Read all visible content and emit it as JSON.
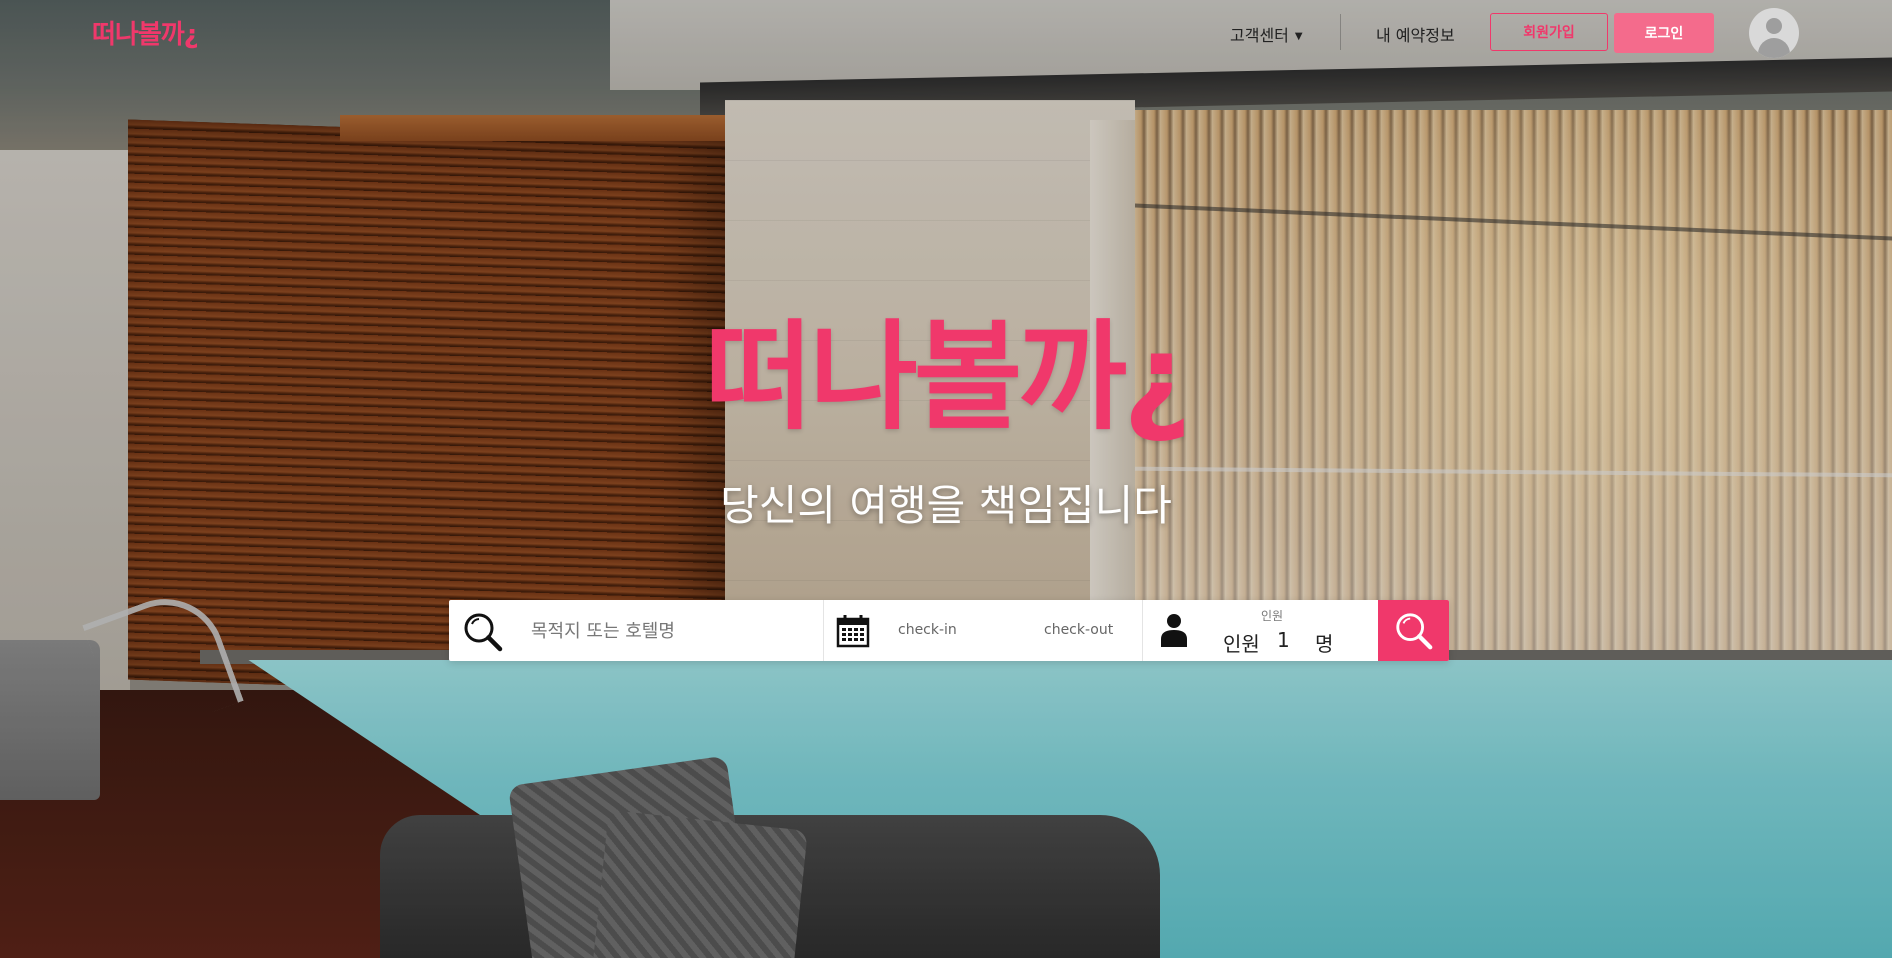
{
  "header": {
    "logo": "떠나볼까¿",
    "nav": {
      "customer_center": "고객센터",
      "customer_center_caret": "▼",
      "my_booking": "내 예약정보"
    },
    "signup_label": "회원가입",
    "login_label": "로그인"
  },
  "hero": {
    "logo": "떠나볼까¿",
    "tagline": "당신의 여행을 책임집니다"
  },
  "search": {
    "destination_placeholder": "목적지 또는 호텔명",
    "destination_value": "",
    "checkin_label": "check-in",
    "checkout_label": "check-out",
    "guest_caption": "인원",
    "guest_label": "인원",
    "guest_count": "1",
    "guest_unit": "명",
    "icons": {
      "destination": "search-icon",
      "date": "calendar-icon",
      "guest": "person-icon",
      "submit": "search-icon"
    }
  },
  "colors": {
    "brand": "#f0386b",
    "login_button": "#f46b8c",
    "search_button": "#f0386b",
    "text_white": "#ffffff"
  }
}
